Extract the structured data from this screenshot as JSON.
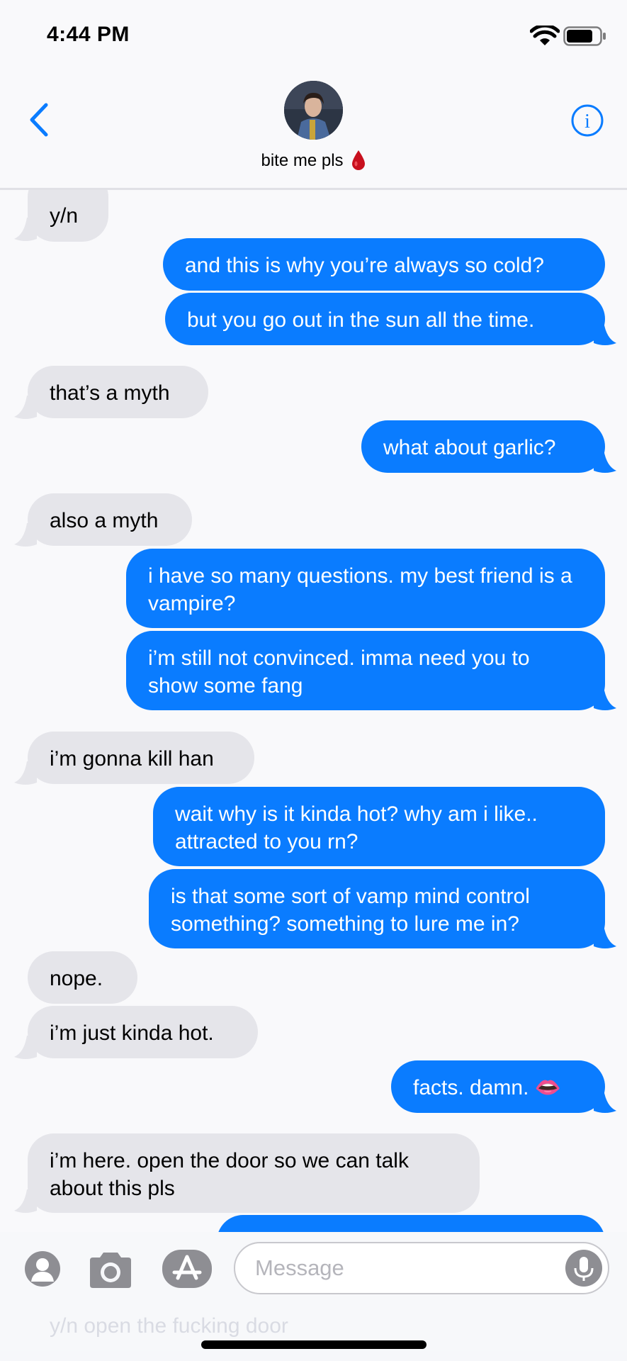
{
  "status_bar": {
    "time": "4:44 PM"
  },
  "header": {
    "contact_name": "bite me pls",
    "avatar_icon": "contact-photo"
  },
  "messages": [
    {
      "dir": "in",
      "text": "y/n"
    },
    {
      "dir": "out",
      "text": "and this is why you’re always so cold?"
    },
    {
      "dir": "out",
      "text": "but you go out in the sun all the time."
    },
    {
      "dir": "in",
      "text": "that’s a myth"
    },
    {
      "dir": "out",
      "text": "what about garlic?"
    },
    {
      "dir": "in",
      "text": "also a myth"
    },
    {
      "dir": "out",
      "text": "i have so many questions. my best friend is a vampire?"
    },
    {
      "dir": "out",
      "text": "i’m still not convinced. imma need you to show some fang"
    },
    {
      "dir": "in",
      "text": "i’m gonna kill han"
    },
    {
      "dir": "out",
      "text": "wait why is it kinda hot? why am i like.. attracted to you rn?"
    },
    {
      "dir": "out",
      "text": "is that some sort of vamp mind control something? something to lure me in?"
    },
    {
      "dir": "in",
      "text": "nope."
    },
    {
      "dir": "in",
      "text": "i’m just kinda hot."
    },
    {
      "dir": "out",
      "text": "facts. damn. 👄"
    },
    {
      "dir": "in",
      "text": "i’m here. open the door so we can talk about this pls"
    }
  ],
  "compose": {
    "placeholder": "Message",
    "hidden_text": "y/n open the fucking door"
  },
  "colors": {
    "accent": "#0a7cff",
    "incoming_bubble": "#e5e5ea",
    "background": "#f9f9fb"
  }
}
